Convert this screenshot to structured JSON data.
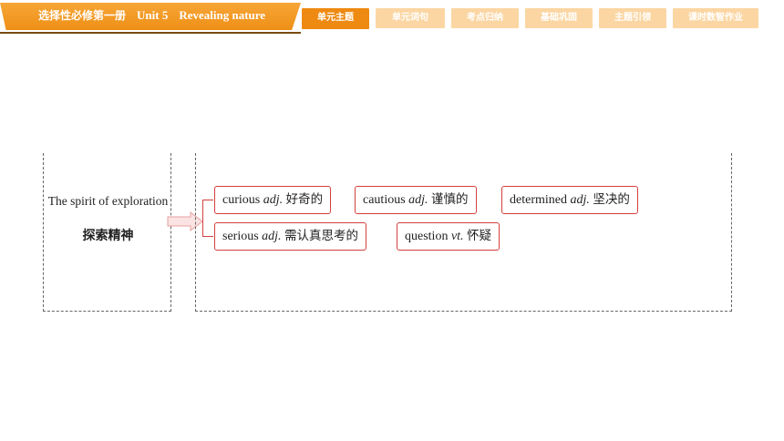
{
  "header": {
    "book": "选择性必修第一册",
    "unit": "Unit 5",
    "unit_name": "Revealing nature",
    "accent_color": "#ee8a12",
    "tab_inactive_color": "#fbd6a3"
  },
  "nav": {
    "tabs": [
      {
        "label": "单元主题",
        "active": true
      },
      {
        "label": "单元词句",
        "active": false
      },
      {
        "label": "考点归纳",
        "active": false
      },
      {
        "label": "基础巩固",
        "active": false
      },
      {
        "label": "主题引领",
        "active": false
      },
      {
        "label": "课时数智作业",
        "active": false
      }
    ]
  },
  "topic": {
    "english": "The spirit of exploration",
    "chinese": "探索精神"
  },
  "words": [
    {
      "word": "curious",
      "pos": "adj.",
      "meaning": "好奇的"
    },
    {
      "word": "cautious",
      "pos": "adj.",
      "meaning": "谨慎的"
    },
    {
      "word": "determined",
      "pos": "adj.",
      "meaning": "坚决的"
    },
    {
      "word": "serious",
      "pos": "adj.",
      "meaning": "需认真思考的"
    },
    {
      "word": "question",
      "pos": "vt.",
      "meaning": "怀疑"
    }
  ],
  "border_color": "#d34040"
}
